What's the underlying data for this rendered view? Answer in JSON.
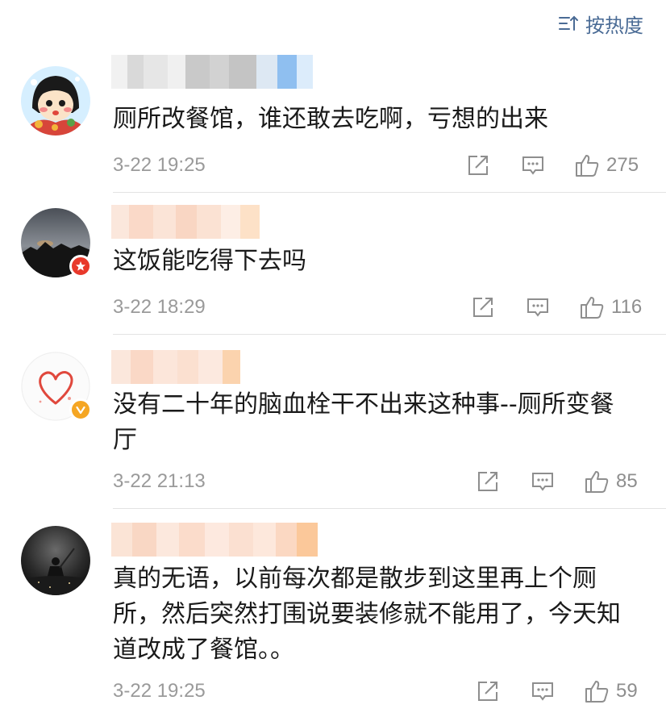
{
  "sort": {
    "label": "按热度",
    "icon": "sort-icon"
  },
  "colors": {
    "link": "#4a6b95",
    "text": "#1a1a1a",
    "meta": "#9a9a9a",
    "vip_orange": "#f5a623",
    "badge_red": "#e8392b"
  },
  "comments": [
    {
      "text": "厕所改餐馆，谁还敢去吃啊，亏想的出来",
      "time": "3-22 19:25",
      "likes": "275",
      "badge": null
    },
    {
      "text": "这饭能吃得下去吗",
      "time": "3-22 18:29",
      "likes": "116",
      "badge": "red-star-badge"
    },
    {
      "text": "没有二十年的脑血栓干不出来这种事--厕所变餐\n厅",
      "time": "3-22 21:13",
      "likes": "85",
      "badge": "orange-v-badge"
    },
    {
      "text": "真的无语，以前每次都是散步到这里再上个厕\n所，然后突然打围说要装修就不能用了，今天知\n道改成了餐馆。。",
      "time": "3-22 19:25",
      "likes": "59",
      "badge": null
    }
  ]
}
